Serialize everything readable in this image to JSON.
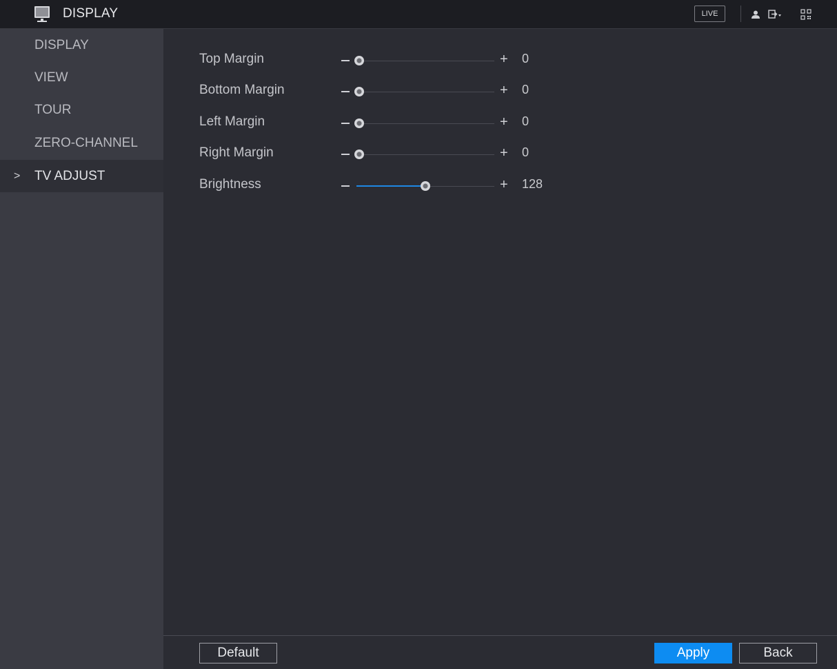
{
  "header": {
    "title": "DISPLAY",
    "live_label": "LIVE",
    "icons": [
      "display-monitor-icon",
      "user-icon",
      "logout-icon",
      "qr-code-icon"
    ]
  },
  "sidebar": {
    "items": [
      {
        "label": "DISPLAY",
        "active": false
      },
      {
        "label": "VIEW",
        "active": false
      },
      {
        "label": "TOUR",
        "active": false
      },
      {
        "label": "ZERO-CHANNEL",
        "active": false
      },
      {
        "label": "TV ADJUST",
        "active": true
      }
    ],
    "active_arrow": ">"
  },
  "settings": [
    {
      "label": "Top Margin",
      "value": "0",
      "level": 0
    },
    {
      "label": "Bottom Margin",
      "value": "0",
      "level": 0
    },
    {
      "label": "Left Margin",
      "value": "0",
      "level": 0
    },
    {
      "label": "Right Margin",
      "value": "0",
      "level": 0
    },
    {
      "label": "Brightness",
      "value": "128",
      "level": 0.5
    }
  ],
  "slider_glyphs": {
    "minus": "−",
    "plus": "+"
  },
  "footer": {
    "default_label": "Default",
    "apply_label": "Apply",
    "back_label": "Back"
  },
  "colors": {
    "accent": "#0d8cf2",
    "slider_fill": "#1e88e5"
  }
}
